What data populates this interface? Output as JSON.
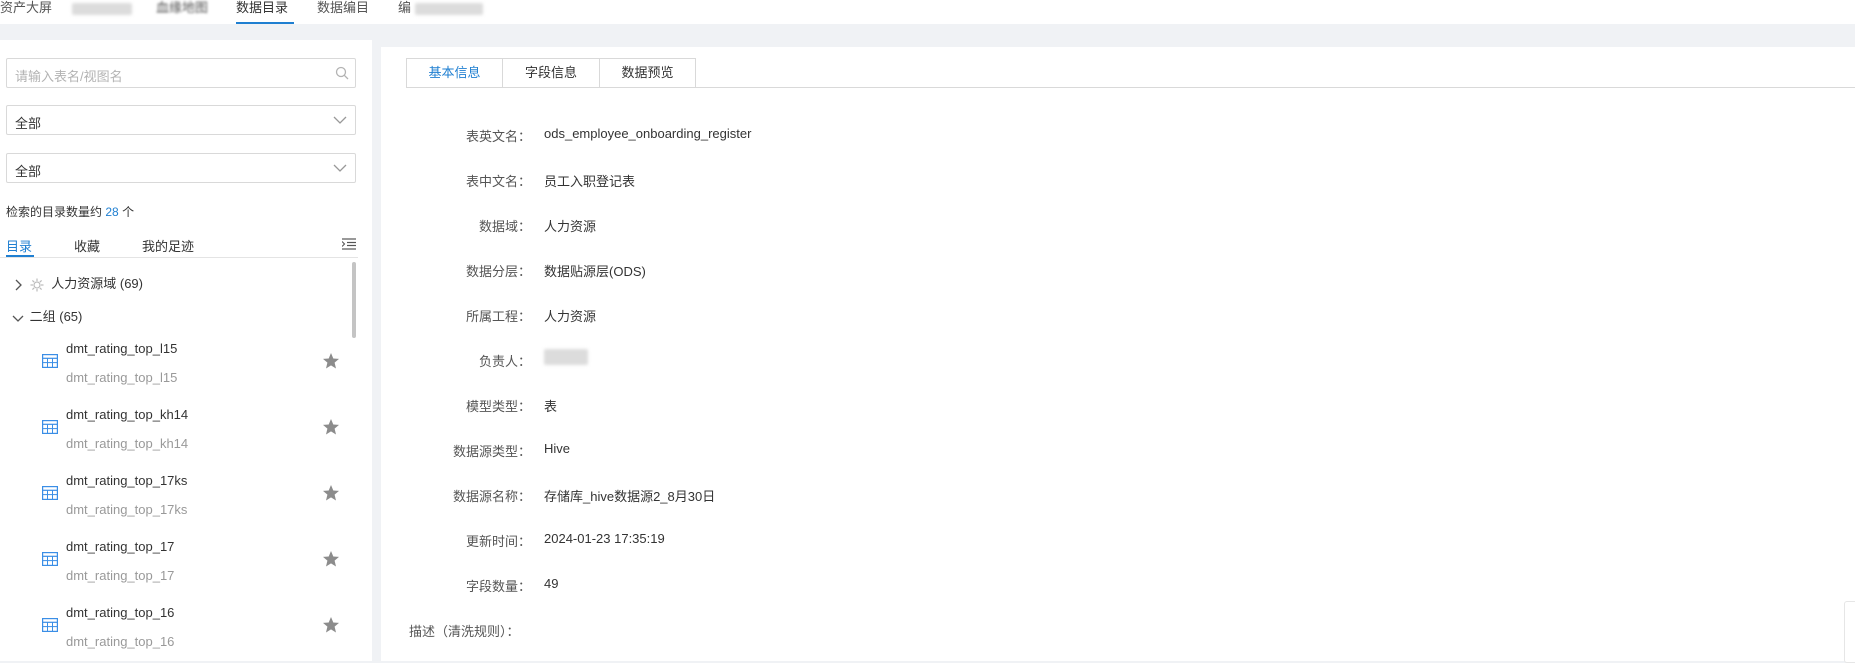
{
  "nav": {
    "items": [
      {
        "label": "资产大屏",
        "active": false
      },
      {
        "label": "",
        "active": false
      },
      {
        "label": "血缘地图",
        "active": false
      },
      {
        "label": "数据目录",
        "active": true
      },
      {
        "label": "数据编目",
        "active": false
      },
      {
        "label": "编",
        "active": false
      }
    ]
  },
  "sidebar": {
    "search_placeholder": "请输入表名/视图名",
    "filter1_value": "全部",
    "filter2_value": "全部",
    "count_prefix": "检索的目录数量约",
    "count_num": "28",
    "count_suffix": "个",
    "tabs": [
      "目录",
      "收藏",
      "我的足迹"
    ],
    "tree": [
      {
        "label": "人力资源域 (69)",
        "expanded": false
      },
      {
        "label": "二组 (65)",
        "expanded": true
      }
    ],
    "rows": [
      {
        "title": "dmt_rating_top_l15",
        "sub": "dmt_rating_top_l15"
      },
      {
        "title": "dmt_rating_top_kh14",
        "sub": "dmt_rating_top_kh14"
      },
      {
        "title": "dmt_rating_top_17ks",
        "sub": "dmt_rating_top_17ks"
      },
      {
        "title": "dmt_rating_top_17",
        "sub": "dmt_rating_top_17"
      },
      {
        "title": "dmt_rating_top_16",
        "sub": "dmt_rating_top_16"
      }
    ]
  },
  "detail": {
    "tabs": [
      "基本信息",
      "字段信息",
      "数据预览"
    ],
    "fields": [
      {
        "label": "表英文名：",
        "value": "ods_employee_onboarding_register"
      },
      {
        "label": "表中文名：",
        "value": "员工入职登记表"
      },
      {
        "label": "数据域：",
        "value": "人力资源"
      },
      {
        "label": "数据分层：",
        "value": "数据贴源层(ODS)"
      },
      {
        "label": "所属工程：",
        "value": "人力资源"
      },
      {
        "label": "负责人：",
        "value": ""
      },
      {
        "label": "模型类型：",
        "value": "表"
      },
      {
        "label": "数据源类型：",
        "value": "Hive"
      },
      {
        "label": "数据源名称：",
        "value": "存储库_hive数据源2_8月30日"
      },
      {
        "label": "更新时间：",
        "value": "2024-01-23 17:35:19"
      },
      {
        "label": "字段数量：",
        "value": "49"
      }
    ],
    "desc_label": "描述（清洗规则）："
  },
  "colors": {
    "accent": "#1f7fd1",
    "border": "#d9d9d9",
    "star": "#8c8c8c"
  }
}
